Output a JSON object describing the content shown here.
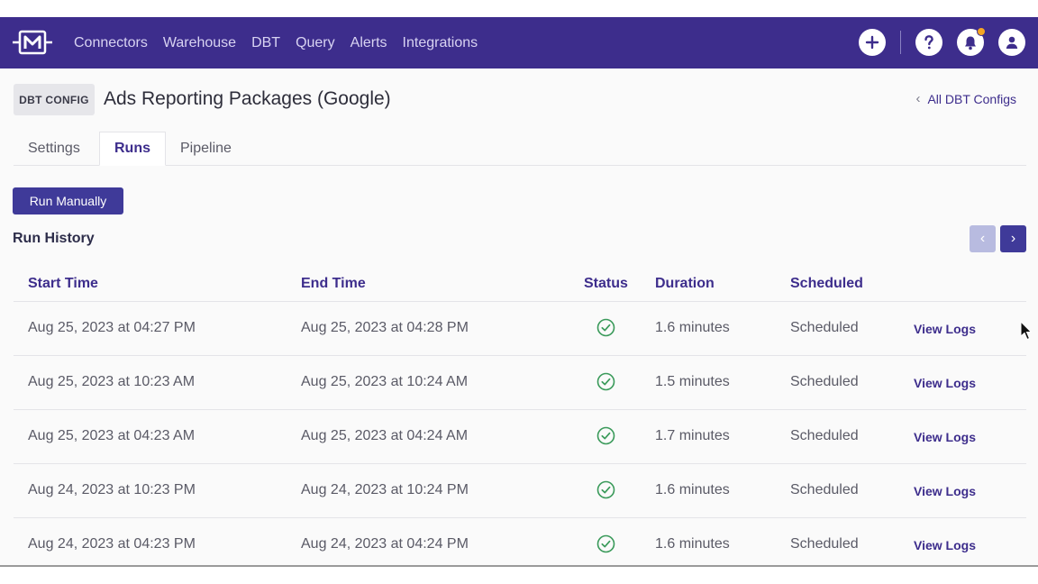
{
  "nav": {
    "links": [
      "Connectors",
      "Warehouse",
      "DBT",
      "Query",
      "Alerts",
      "Integrations"
    ],
    "icons": [
      "plus-icon",
      "help-icon",
      "bell-icon",
      "user-icon"
    ],
    "brand_color": "#3d2d8c",
    "notification_dot_color": "#f5a623"
  },
  "header": {
    "badge": "DBT CONFIG",
    "title": "Ads Reporting Packages (Google)",
    "back_link": "All DBT Configs"
  },
  "tabs": [
    {
      "label": "Settings",
      "active": false
    },
    {
      "label": "Runs",
      "active": true
    },
    {
      "label": "Pipeline",
      "active": false
    }
  ],
  "actions": {
    "run_manually": "Run Manually"
  },
  "run_history": {
    "title": "Run History",
    "columns": [
      "Start Time",
      "End Time",
      "Status",
      "Duration",
      "Scheduled"
    ],
    "rows": [
      {
        "start": "Aug 25, 2023 at 04:27 PM",
        "end": "Aug 25, 2023 at 04:28 PM",
        "status": "success",
        "duration": "1.6 minutes",
        "scheduled": "Scheduled",
        "action": "View Logs"
      },
      {
        "start": "Aug 25, 2023 at 10:23 AM",
        "end": "Aug 25, 2023 at 10:24 AM",
        "status": "success",
        "duration": "1.5 minutes",
        "scheduled": "Scheduled",
        "action": "View Logs"
      },
      {
        "start": "Aug 25, 2023 at 04:23 AM",
        "end": "Aug 25, 2023 at 04:24 AM",
        "status": "success",
        "duration": "1.7 minutes",
        "scheduled": "Scheduled",
        "action": "View Logs"
      },
      {
        "start": "Aug 24, 2023 at 10:23 PM",
        "end": "Aug 24, 2023 at 10:24 PM",
        "status": "success",
        "duration": "1.6 minutes",
        "scheduled": "Scheduled",
        "action": "View Logs"
      },
      {
        "start": "Aug 24, 2023 at 04:23 PM",
        "end": "Aug 24, 2023 at 04:24 PM",
        "status": "success",
        "duration": "1.6 minutes",
        "scheduled": "Scheduled",
        "action": "View Logs"
      }
    ],
    "status_color": "#3a9a5a"
  }
}
